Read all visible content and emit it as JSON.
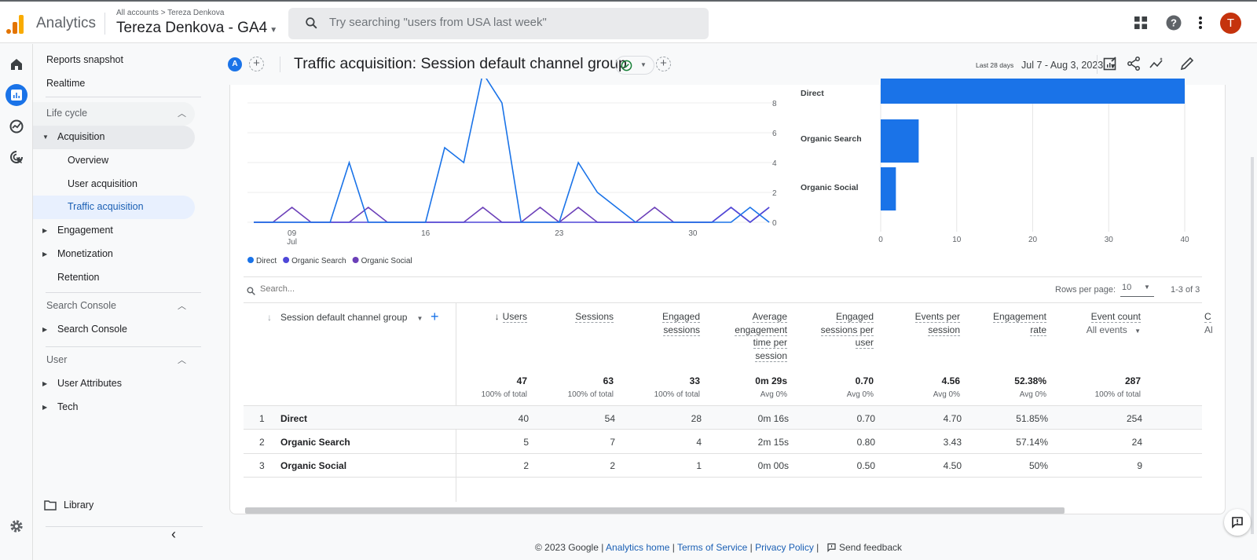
{
  "topbar": {
    "app_name": "Analytics",
    "breadcrumb": "All accounts > Tereza Denkova",
    "property_name": "Tereza Denkova - GA4",
    "search_placeholder": "Try searching \"users from USA last week\"",
    "avatar_letter": "T",
    "avatar_color": "#c5330d",
    "icons": [
      "apps-grid-icon",
      "help-icon",
      "more-vert-icon"
    ]
  },
  "rail": {
    "items": [
      "home-icon",
      "reports-icon",
      "explore-icon",
      "advertising-icon"
    ],
    "active": "reports-icon",
    "settings_icon": "gear-icon"
  },
  "nav": {
    "top_items": [
      "Reports snapshot",
      "Realtime"
    ],
    "sections": [
      {
        "label": "Life cycle",
        "items": [
          {
            "label": "Acquisition",
            "expanded": true,
            "children": [
              "Overview",
              "User acquisition",
              "Traffic acquisition"
            ]
          },
          {
            "label": "Engagement"
          },
          {
            "label": "Monetization"
          },
          {
            "label": "Retention"
          }
        ]
      },
      {
        "label": "Search Console",
        "items": [
          {
            "label": "Search Console"
          }
        ]
      },
      {
        "label": "User",
        "items": [
          {
            "label": "User Attributes"
          },
          {
            "label": "Tech"
          }
        ]
      }
    ],
    "active_item": "Traffic acquisition",
    "library": "Library"
  },
  "titlebar": {
    "comparison_chip": "A",
    "title": "Traffic acquisition: Session default channel group",
    "date_label": "Last 28 days",
    "date_range": "Jul 7 - Aug 3, 2023"
  },
  "chart_data": [
    {
      "type": "line",
      "title": "",
      "x": [
        "Jul 7",
        "Jul 8",
        "Jul 9",
        "Jul 10",
        "Jul 11",
        "Jul 12",
        "Jul 13",
        "Jul 14",
        "Jul 15",
        "Jul 16",
        "Jul 17",
        "Jul 18",
        "Jul 19",
        "Jul 20",
        "Jul 21",
        "Jul 22",
        "Jul 23",
        "Jul 24",
        "Jul 25",
        "Jul 26",
        "Jul 27",
        "Jul 28",
        "Jul 29",
        "Jul 30",
        "Jul 31",
        "Aug 1",
        "Aug 2",
        "Aug 3"
      ],
      "x_tick_labels": [
        "09\nJul",
        "16",
        "23",
        "30"
      ],
      "y_tick_labels": [
        "0",
        "2",
        "4",
        "6",
        "8"
      ],
      "ylim": [
        0,
        9.5
      ],
      "grid": true,
      "legend_position": "bottom-left",
      "series": [
        {
          "name": "Direct",
          "color": "#1a73e8",
          "values": [
            0,
            0,
            0,
            0,
            0,
            4,
            0,
            0,
            0,
            0,
            5,
            4,
            10,
            8,
            0,
            0,
            0,
            4,
            2,
            1,
            0,
            0,
            0,
            0,
            0,
            0,
            1,
            0
          ]
        },
        {
          "name": "Organic Search",
          "color": "#4e47d8",
          "values": [
            0,
            0,
            0,
            0,
            0,
            0,
            0,
            0,
            0,
            0,
            0,
            0,
            0,
            0,
            0,
            0,
            0,
            0,
            0,
            0,
            0,
            0,
            0,
            0,
            0,
            1,
            0,
            1
          ]
        },
        {
          "name": "Organic Social",
          "color": "#6b3fb8",
          "values": [
            0,
            0,
            1,
            0,
            0,
            0,
            1,
            0,
            0,
            0,
            0,
            0,
            1,
            0,
            0,
            1,
            0,
            1,
            0,
            0,
            0,
            1,
            0,
            0,
            0,
            1,
            0,
            1
          ]
        }
      ]
    },
    {
      "type": "bar",
      "orientation": "horizontal",
      "categories": [
        "Direct",
        "Organic Search",
        "Organic Social"
      ],
      "values": [
        40,
        5,
        2
      ],
      "color": "#1a73e8",
      "x_tick_labels": [
        "0",
        "10",
        "20",
        "30",
        "40"
      ],
      "xlim": [
        0,
        40
      ],
      "grid": true
    }
  ],
  "table": {
    "search_placeholder": "Search...",
    "rows_per_page_label": "Rows per page:",
    "rows_per_page": "10",
    "pagination": "1-3 of 3",
    "dimension_header": "Session default channel group",
    "columns": [
      {
        "label": "Users",
        "sorted": true,
        "total": "47",
        "sub": "100% of total"
      },
      {
        "label": "Sessions",
        "total": "63",
        "sub": "100% of total"
      },
      {
        "label": "Engaged sessions",
        "total": "33",
        "sub": "100% of total"
      },
      {
        "label": "Average engagement time per session",
        "total": "0m 29s",
        "sub": "Avg 0%"
      },
      {
        "label": "Engaged sessions per user",
        "total": "0.70",
        "sub": "Avg 0%"
      },
      {
        "label": "Events per session",
        "total": "4.56",
        "sub": "Avg 0%"
      },
      {
        "label": "Engagement rate",
        "total": "52.38%",
        "sub": "Avg 0%"
      },
      {
        "label": "Event count",
        "filter": "All events",
        "total": "287",
        "sub": "100% of total"
      },
      {
        "label": "C",
        "filter": "Al"
      }
    ],
    "rows": [
      {
        "rank": "1",
        "channel": "Direct",
        "values": [
          "40",
          "54",
          "28",
          "0m 16s",
          "0.70",
          "4.70",
          "51.85%",
          "254"
        ]
      },
      {
        "rank": "2",
        "channel": "Organic Search",
        "values": [
          "5",
          "7",
          "4",
          "2m 15s",
          "0.80",
          "3.43",
          "57.14%",
          "24"
        ]
      },
      {
        "rank": "3",
        "channel": "Organic Social",
        "values": [
          "2",
          "2",
          "1",
          "0m 00s",
          "0.50",
          "4.50",
          "50%",
          "9"
        ]
      }
    ]
  },
  "footer": {
    "copyright": "© 2023 Google |",
    "links": [
      "Analytics home",
      "Terms of Service",
      "Privacy Policy"
    ],
    "feedback": "Send feedback"
  }
}
